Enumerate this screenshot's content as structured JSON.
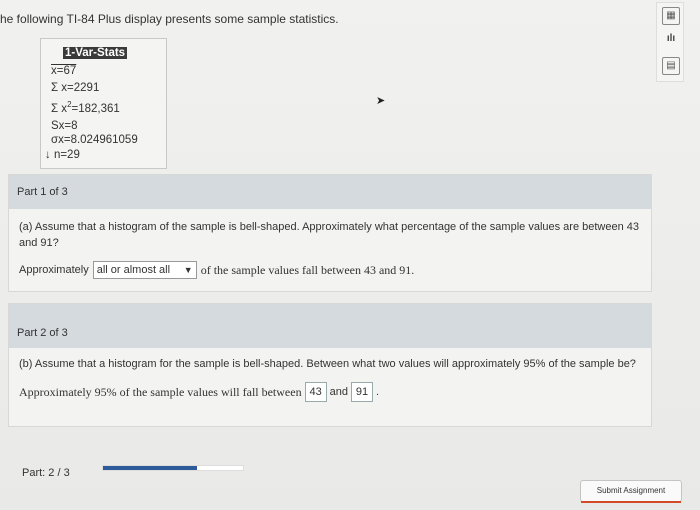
{
  "intro": "he following TI-84 Plus display presents some sample statistics.",
  "calc": {
    "title": "1-Var-Stats",
    "xbar": "x=67",
    "sum_x": "Σ x=2291",
    "sum_x2_prefix": "Σ x",
    "sum_x2_sup": "2",
    "sum_x2_suffix": "=182,361",
    "sx": "Sx=8",
    "sigma_x": "σx=8.024961059",
    "n": "↓ n=29"
  },
  "tools": {
    "icon1": "▦",
    "icon2": "ılı",
    "icon3": "▤"
  },
  "part1": {
    "header": "Part 1 of 3",
    "question": "(a) Assume that a histogram of the sample is bell-shaped. Approximately what percentage of the sample values are between 43 and 91?",
    "approx_label": "Approximately",
    "select_value": "all or almost all",
    "select_arrow": "▼",
    "suffix": "of the sample values fall between 43 and 91."
  },
  "part2": {
    "header": "Part 2 of 3",
    "question": "(b) Assume that a histogram for the sample is bell-shaped. Between what two values will approximately 95% of the sample be?",
    "prefix": "Approximately 95% of the sample values will fall between",
    "value1": "43",
    "and": "and",
    "value2": "91",
    "end": "."
  },
  "progress": {
    "label": "Part: 2 / 3",
    "fraction": 0.67
  },
  "submit_label": "Submit Assignment",
  "colors": {
    "progress_fill": "#2e5b9a",
    "header_bg": "#d4dade",
    "submit_accent": "#d34a2a"
  }
}
